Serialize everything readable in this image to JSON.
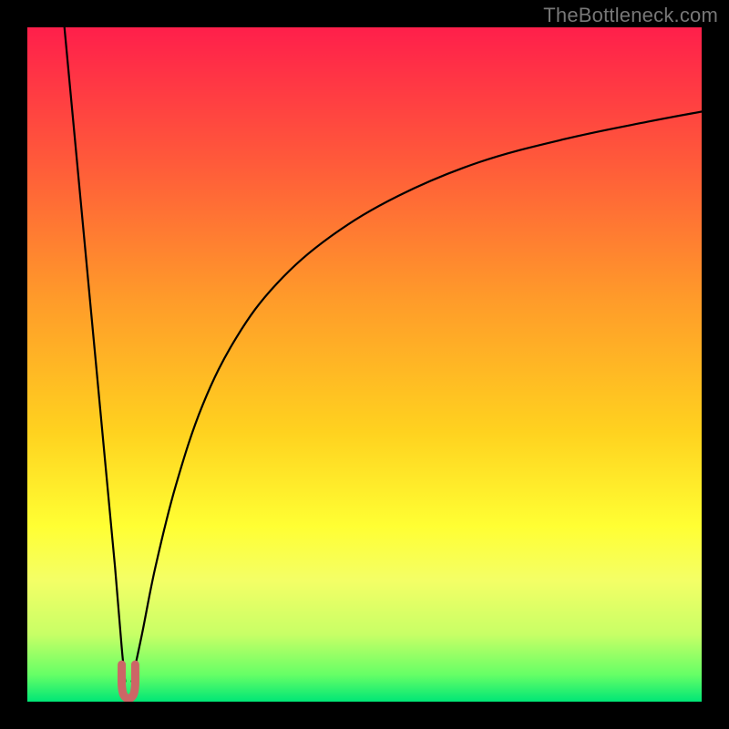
{
  "watermark": {
    "text": "TheBottleneck.com"
  },
  "colors": {
    "frame": "#000000",
    "curve": "#000000",
    "notch_fill": "#cc6666",
    "gradient_stops": [
      {
        "offset": 0.0,
        "color": "#ff1f4b"
      },
      {
        "offset": 0.2,
        "color": "#ff5a3a"
      },
      {
        "offset": 0.4,
        "color": "#ff9a2a"
      },
      {
        "offset": 0.6,
        "color": "#ffd21f"
      },
      {
        "offset": 0.74,
        "color": "#ffff33"
      },
      {
        "offset": 0.82,
        "color": "#f4ff66"
      },
      {
        "offset": 0.9,
        "color": "#c8ff66"
      },
      {
        "offset": 0.96,
        "color": "#66ff66"
      },
      {
        "offset": 1.0,
        "color": "#00e676"
      }
    ]
  },
  "chart_data": {
    "type": "line",
    "title": "",
    "xlabel": "",
    "ylabel": "",
    "xlim": [
      0,
      100
    ],
    "ylim": [
      0,
      100
    ],
    "notch_x": 15,
    "series": [
      {
        "name": "left-branch",
        "x": [
          5.5,
          7,
          8.5,
          10,
          11.5,
          13,
          14,
          14.5
        ],
        "values": [
          100,
          84,
          68,
          52,
          36,
          20,
          8,
          3
        ]
      },
      {
        "name": "right-branch",
        "x": [
          15.5,
          17,
          19,
          22,
          26,
          31,
          37,
          45,
          55,
          67,
          80,
          92,
          100
        ],
        "values": [
          3,
          10,
          20,
          32,
          44,
          54,
          62,
          69,
          75,
          80,
          83.5,
          86,
          87.5
        ]
      }
    ],
    "notch": {
      "name": "minimum-notch",
      "x": [
        14.0,
        14.0,
        14.2,
        14.6,
        15.0,
        15.4,
        15.8,
        16.0,
        16.0
      ],
      "values": [
        5.5,
        2.5,
        1.2,
        0.6,
        0.5,
        0.6,
        1.2,
        2.5,
        5.5
      ]
    }
  }
}
